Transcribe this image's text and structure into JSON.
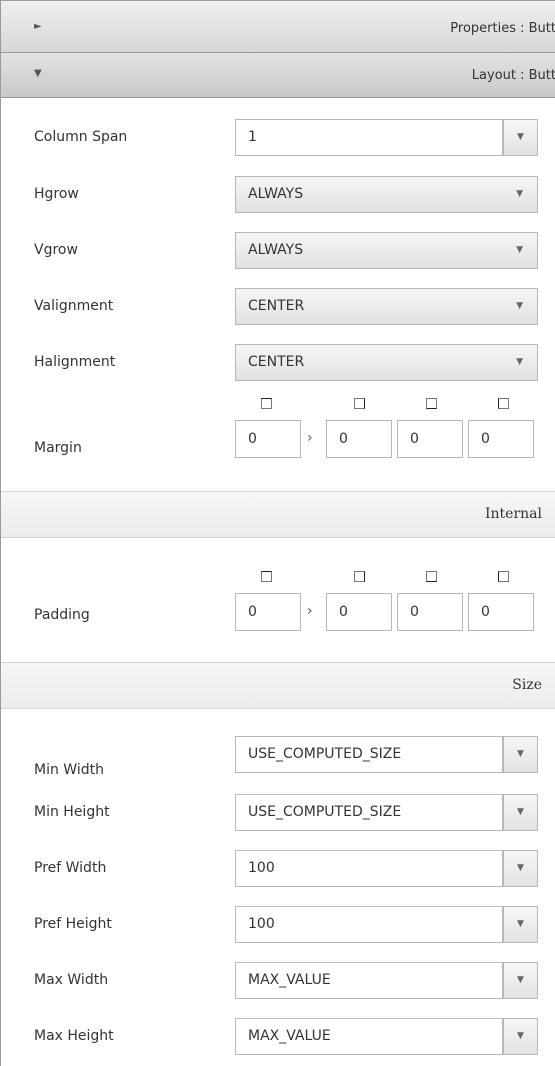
{
  "header": {
    "properties_title": "Properties : Butt",
    "layout_title": "Layout : Butt",
    "collapsed_arrow": "►",
    "expanded_arrow": "▼"
  },
  "layout": {
    "column_span": {
      "label": "Column Span",
      "value": "1"
    },
    "hgrow": {
      "label": "Hgrow",
      "value": "ALWAYS"
    },
    "vgrow": {
      "label": "Vgrow",
      "value": "ALWAYS"
    },
    "valignment": {
      "label": "Valignment",
      "value": "CENTER"
    },
    "halignment": {
      "label": "Halignment",
      "value": "CENTER"
    },
    "margin": {
      "label": "Margin",
      "values": [
        "0",
        "0",
        "0",
        "0"
      ]
    }
  },
  "internal": {
    "section_label": "Internal",
    "padding": {
      "label": "Padding",
      "values": [
        "0",
        "0",
        "0",
        "0"
      ]
    }
  },
  "size": {
    "section_label": "Size",
    "min_width": {
      "label": "Min Width",
      "value": "USE_COMPUTED_SIZE"
    },
    "min_height": {
      "label": "Min Height",
      "value": "USE_COMPUTED_SIZE"
    },
    "pref_width": {
      "label": "Pref Width",
      "value": "100"
    },
    "pref_height": {
      "label": "Pref Height",
      "value": "100"
    },
    "max_width": {
      "label": "Max Width",
      "value": "MAX_VALUE"
    },
    "max_height": {
      "label": "Max Height",
      "value": "MAX_VALUE"
    }
  },
  "icons": {
    "combo_caret": "chevron-down-icon",
    "link_arrow": "chevron-right-icon",
    "side_indicator": "inset-side-icon"
  },
  "colors": {
    "border": "#b8b8b8",
    "titlebar": "#d6d6d6"
  }
}
